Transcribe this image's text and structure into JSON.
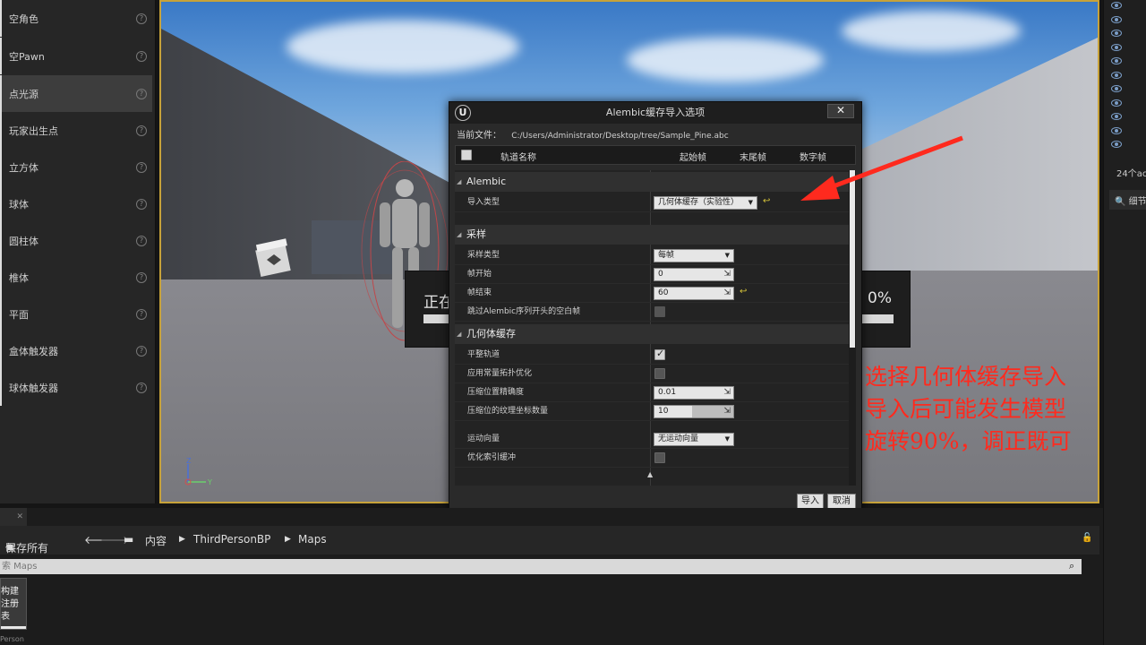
{
  "left_panel": {
    "items": [
      {
        "label": "空角色"
      },
      {
        "label": "空Pawn"
      },
      {
        "label": "点光源"
      },
      {
        "label": "玩家出生点"
      },
      {
        "label": "立方体"
      },
      {
        "label": "球体"
      },
      {
        "label": "圆柱体"
      },
      {
        "label": "椎体"
      },
      {
        "label": "平面"
      },
      {
        "label": "盒体触发器"
      },
      {
        "label": "球体触发器"
      }
    ],
    "selected_index": 2,
    "help_glyph": "?"
  },
  "viewport": {
    "progress_left_text": "正在",
    "progress_right_text": "0%"
  },
  "dialog": {
    "title": "Alembic缓存导入选项",
    "logo_glyph": "U",
    "close_glyph": "✕",
    "current_file_label": "当前文件：",
    "current_file_path": "C:/Users/Administrator/Desktop/tree/Sample_Pine.abc",
    "track_header": {
      "name": "轨道名称",
      "start": "起始帧",
      "end": "末尾帧",
      "frames": "数字帧"
    },
    "sections": {
      "alembic": {
        "title": "Alembic",
        "import_type_label": "导入类型",
        "import_type_value": "几何体缓存（实验性）"
      },
      "sampling": {
        "title": "采样",
        "sampling_type_label": "采样类型",
        "sampling_type_value": "每帧",
        "frame_start_label": "帧开始",
        "frame_start_value": "0",
        "frame_end_label": "帧结束",
        "frame_end_value": "60",
        "skip_empty_label": "跳过Alembic序列开头的空白帧",
        "skip_empty_checked": false
      },
      "geometry_cache": {
        "title": "几何体缓存",
        "flatten_tracks_label": "平整轨道",
        "flatten_tracks_checked": true,
        "apply_constant_topology_label": "应用常量拓扑优化",
        "apply_constant_topology_checked": false,
        "position_precision_label": "压缩位置精确度",
        "position_precision_value": "0.01",
        "texcoord_bits_label": "压缩位的纹理坐标数量",
        "texcoord_bits_value": "10",
        "motion_vectors_label": "运动向量",
        "motion_vectors_value": "无运动向量",
        "optimize_index_label": "优化索引缓冲",
        "optimize_index_checked": false
      }
    },
    "import_button": "导入",
    "cancel_button": "取消"
  },
  "annotation": {
    "lines": [
      "选择几何体缓存导入",
      "导入后可能发生模型",
      "旋转90%，调正既可"
    ],
    "color": "#ff2a1e"
  },
  "right_panel": {
    "actor_count": "24个ac",
    "details_tab": "细节",
    "eye_rows": 11
  },
  "content_browser": {
    "tab_close": "✕",
    "save_all": "保存所有",
    "breadcrumb": [
      "内容",
      "ThirdPersonBP",
      "Maps"
    ],
    "search_placeholder": "索 Maps",
    "asset_tile_lines": [
      "构建",
      "注册",
      "表"
    ],
    "asset_caption": "Person"
  },
  "colors": {
    "viewport_border": "#c7a23a",
    "annotation": "#ff2a1e",
    "eye_icon": "#7b9ec8"
  }
}
